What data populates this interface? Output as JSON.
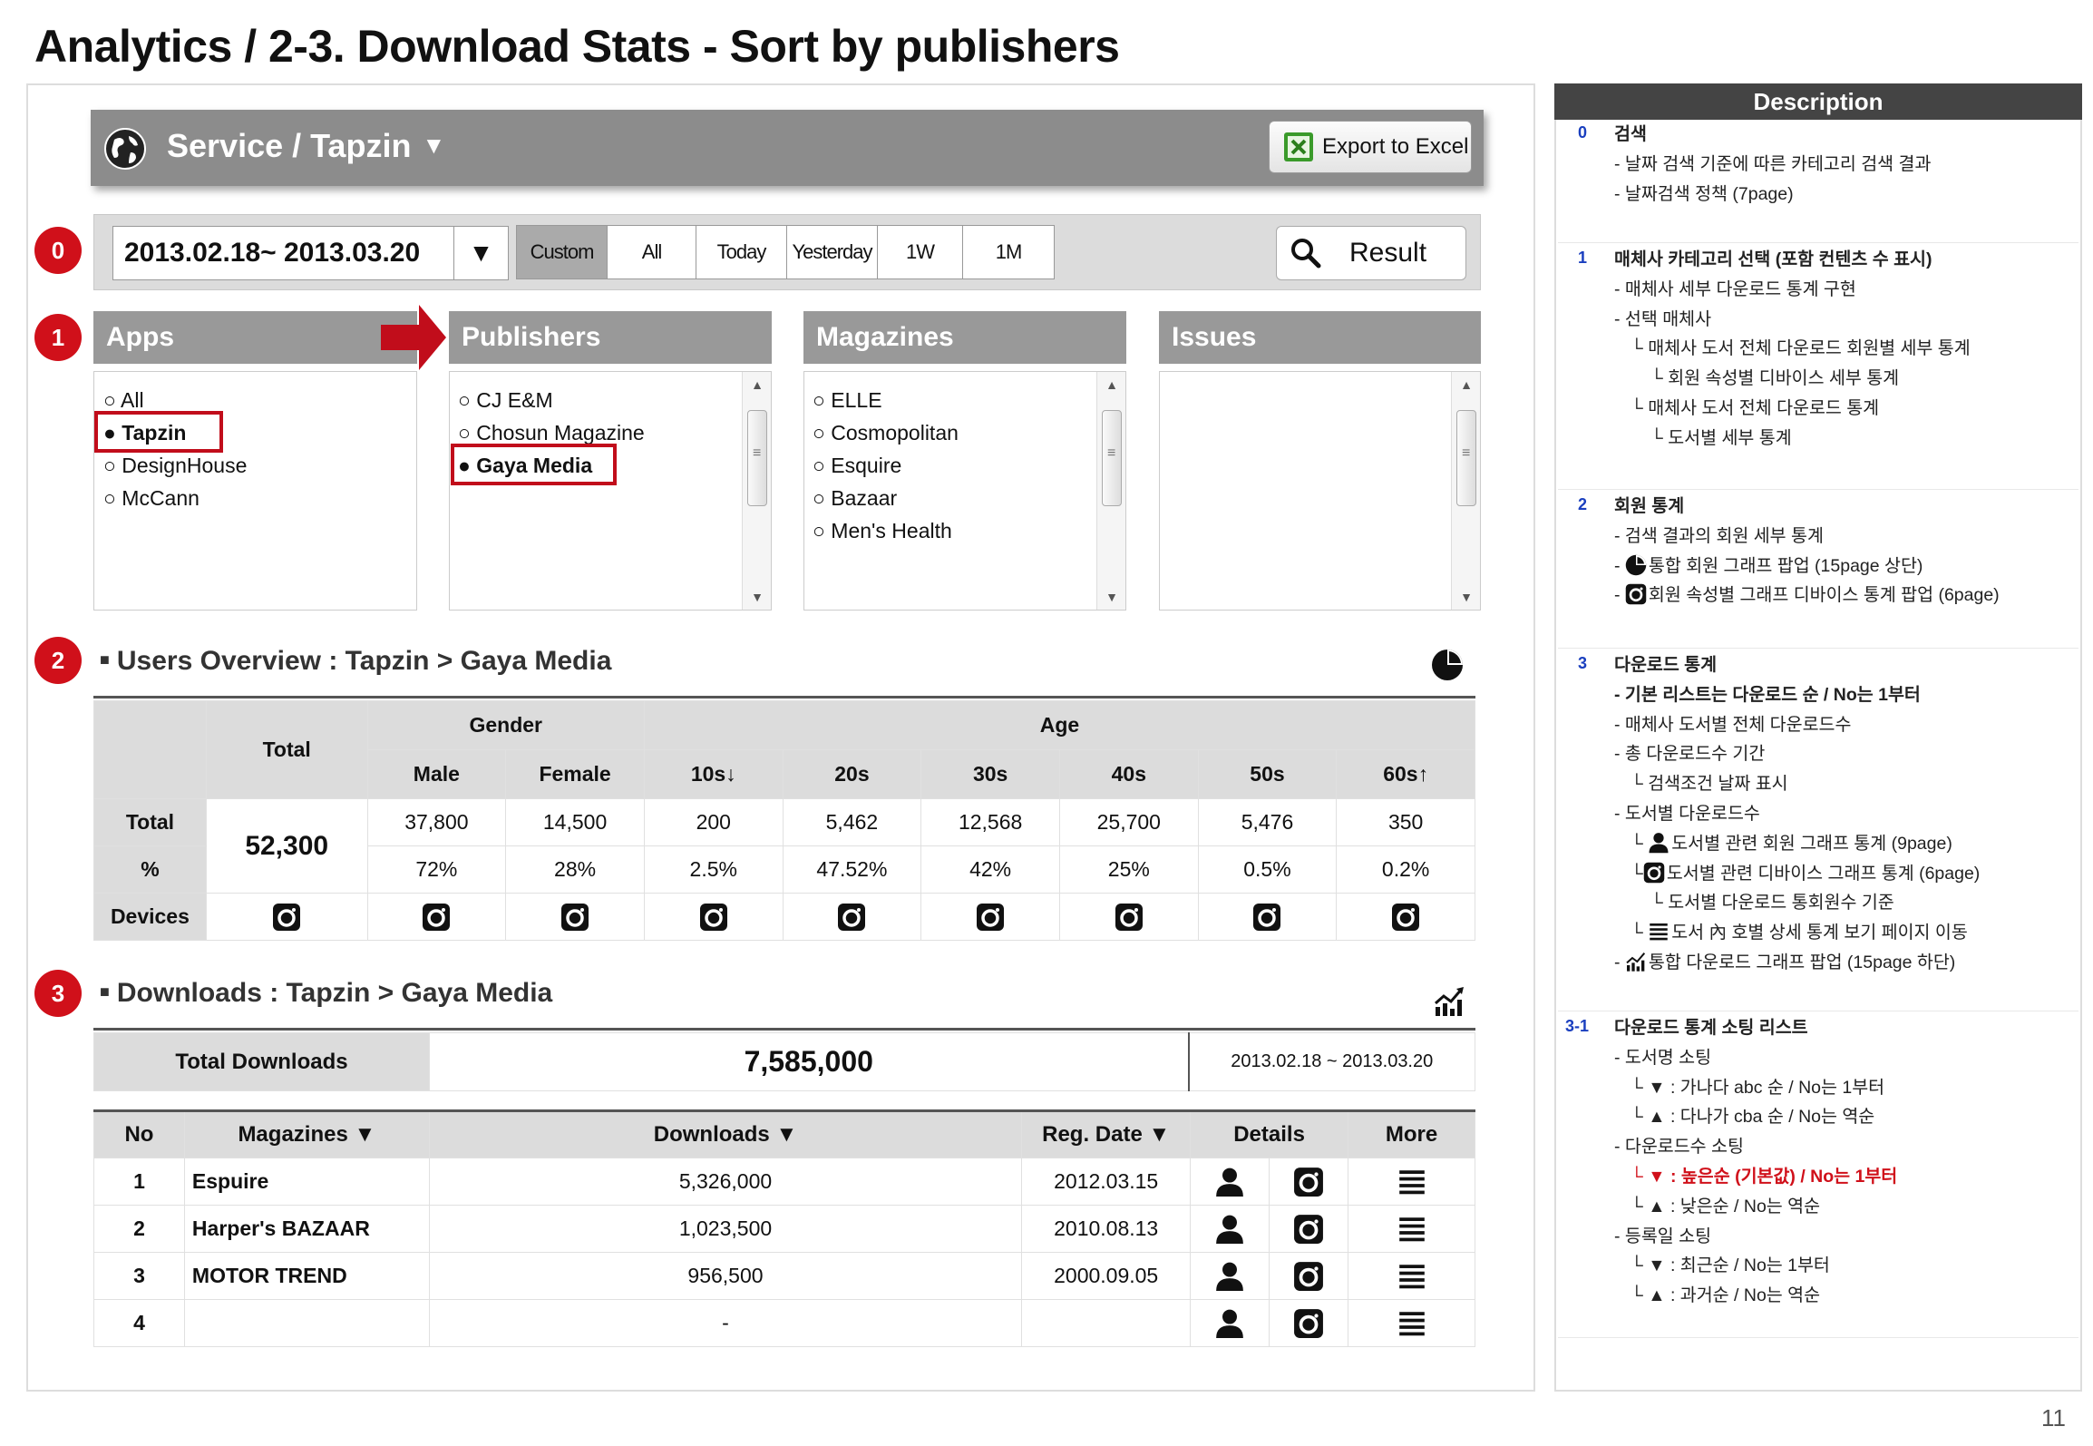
{
  "slide": {
    "title": "Analytics / 2-3. Download Stats - Sort by publishers",
    "page_number": "11"
  },
  "header": {
    "service_title": "Service / Tapzin",
    "caret": "▼",
    "export_label": "Export to Excel"
  },
  "badges": {
    "b0": "0",
    "b1": "1",
    "b2": "2",
    "b3": "3"
  },
  "search": {
    "date_range": "2013.02.18~ 2013.03.20",
    "dropdown_arrow": "▼",
    "presets": [
      "Custom",
      "All",
      "Today",
      "Yesterday",
      "1W",
      "1M"
    ],
    "active_preset": "Custom",
    "result_label": "Result"
  },
  "columns": {
    "apps": {
      "title": "Apps",
      "items": [
        "○ All",
        "● Tapzin",
        "○ DesignHouse",
        "○ McCann"
      ]
    },
    "publishers": {
      "title": "Publishers",
      "items": [
        "○ CJ E&M",
        "○ Chosun Magazine",
        "● Gaya Media"
      ]
    },
    "magazines": {
      "title": "Magazines",
      "items": [
        "○ ELLE",
        "○ Cosmopolitan",
        "○ Esquire",
        "○ Bazaar",
        "○ Men's Health"
      ]
    },
    "issues": {
      "title": "Issues"
    }
  },
  "users_overview": {
    "title": "Users Overview : Tapzin > Gaya Media",
    "headers": {
      "total": "Total",
      "gender": "Gender",
      "age": "Age",
      "male": "Male",
      "female": "Female",
      "ages": [
        "10s↓",
        "20s",
        "30s",
        "40s",
        "50s",
        "60s↑"
      ]
    },
    "row_labels": {
      "total": "Total",
      "percent": "%",
      "devices": "Devices"
    },
    "grand_total": "52,300",
    "totals": [
      "37,800",
      "14,500",
      "200",
      "5,462",
      "12,568",
      "25,700",
      "5,476",
      "350"
    ],
    "percents": [
      "72%",
      "28%",
      "2.5%",
      "47.52%",
      "42%",
      "25%",
      "0.5%",
      "0.2%"
    ]
  },
  "downloads": {
    "title": "Downloads : Tapzin > Gaya Media",
    "total_label": "Total Downloads",
    "total_value": "7,585,000",
    "date_range": "2013.02.18 ~ 2013.03.20",
    "headers": {
      "no": "No",
      "magazines": "Magazines ▼",
      "downloads": "Downloads ▼",
      "reg_date": "Reg. Date ▼",
      "details": "Details",
      "more": "More"
    },
    "rows": [
      {
        "no": "1",
        "magazine": "Espuire",
        "downloads": "5,326,000",
        "reg_date": "2012.03.15"
      },
      {
        "no": "2",
        "magazine": "Harper's BAZAAR",
        "downloads": "1,023,500",
        "reg_date": "2010.08.13"
      },
      {
        "no": "3",
        "magazine": "MOTOR TREND",
        "downloads": "956,500",
        "reg_date": "2000.09.05"
      },
      {
        "no": "4",
        "magazine": "",
        "downloads": "-",
        "reg_date": ""
      }
    ]
  },
  "description": {
    "header": "Description",
    "sections": [
      {
        "num": "0",
        "lines": [
          {
            "text": "검색",
            "style": "b"
          },
          {
            "text": "- 날짜 검색 기준에 따른 카테고리 검색 결과"
          },
          {
            "text": "- 날짜검색 정책 (7page)"
          }
        ]
      },
      {
        "num": "1",
        "lines": [
          {
            "text": "매체사 카테고리 선택 (포함 컨텐츠 수 표시)",
            "style": "b"
          },
          {
            "text": "- 매체사 세부 다운로드 통계 구현"
          },
          {
            "text": "- 선택 매체사"
          },
          {
            "text": "└ 매체사 도서 전체 다운로드 회원별 세부 통계",
            "indent": 2
          },
          {
            "text": "└ 회원 속성별 디바이스 세부 통계",
            "indent": 3
          },
          {
            "text": "└ 매체사 도서 전체 다운로드 통계",
            "indent": 2
          },
          {
            "text": "└ 도서별 세부 통계",
            "indent": 3
          }
        ]
      },
      {
        "num": "2",
        "lines": [
          {
            "text": "회원 통계",
            "style": "b"
          },
          {
            "text": "- 검색 결과의 회원 세부 통계"
          },
          {
            "text": "통합 회원 그래프 팝업 (15page 상단)",
            "prefix": "- ",
            "icon": "pie-icon"
          },
          {
            "text": "회원 속성별 그래프 디바이스 통계 팝업 (6page)",
            "prefix": "- ",
            "icon": "camera-icon"
          }
        ]
      },
      {
        "num": "3",
        "lines": [
          {
            "text": "다운로드 통계",
            "style": "b"
          },
          {
            "text": "- 기본 리스트는 다운로드 순 / No는 1부터",
            "style": "b"
          },
          {
            "text": "- 매체사 도서별 전체 다운로드수"
          },
          {
            "text": "- 총 다운로드수 기간"
          },
          {
            "text": "└ 검색조건 날짜 표시",
            "indent": 2
          },
          {
            "text": "- 도서별 다운로드수"
          },
          {
            "text": "도서별 관련 회원 그래프 통계 (9page)",
            "prefix": "└ ",
            "indent": 2,
            "icon": "user-icon"
          },
          {
            "text": "도서별 관련 디바이스 그래프 통계 (6page)",
            "prefix": "└",
            "indent": 2,
            "icon": "camera-icon"
          },
          {
            "text": "└ 도서별 다운로드 통회원수 기준",
            "indent": 3
          },
          {
            "text": "도서 內 호별 상세 통계 보기 페이지 이동",
            "prefix": "└ ",
            "indent": 2,
            "icon": "list-icon"
          },
          {
            "text": "통합 다운로드 그래프 팝업 (15page 하단)",
            "prefix": "- ",
            "icon": "trend-chart-icon"
          }
        ]
      },
      {
        "num": "3-1",
        "lines": [
          {
            "text": "다운로드 통계 소팅 리스트",
            "style": "b"
          },
          {
            "text": "- 도서명 소팅"
          },
          {
            "text": "└ ▼ : 가나다 abc 순 / No는 1부터",
            "indent": 2
          },
          {
            "text": "└ ▲ : 다나가 cba 순 / No는 역순",
            "indent": 2
          },
          {
            "text": "-  다운로드수 소팅"
          },
          {
            "text": "└ ▼ : 높은순 (기본값) / No는 1부터",
            "indent": 2,
            "style": "red"
          },
          {
            "text": "└ ▲ : 낮은순 / No는 역순",
            "indent": 2
          },
          {
            "text": "- 등록일 소팅"
          },
          {
            "text": "└ ▼ : 최근순 / No는 1부터",
            "indent": 2
          },
          {
            "text": "└ ▲ : 과거순 / No는 역순",
            "indent": 2
          }
        ]
      }
    ]
  },
  "colors": {
    "accent_red": "#d0101a",
    "header_gray": "#8c8c8c",
    "column_header_gray": "#999999",
    "link_blue": "#1a3fbf"
  }
}
